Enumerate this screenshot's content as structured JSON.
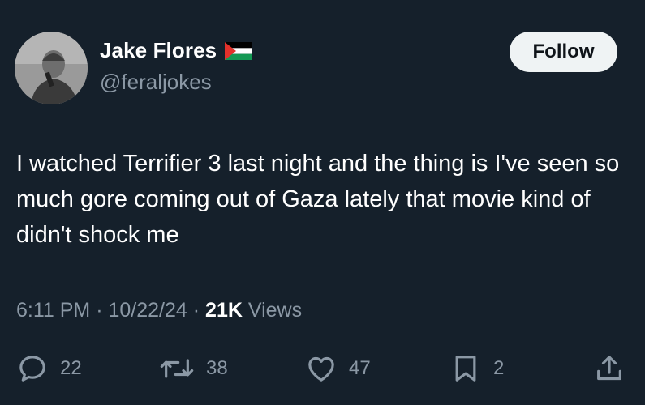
{
  "author": {
    "display_name": "Jake Flores",
    "handle": "@feraljokes",
    "flag_icon": "palestine-flag-icon"
  },
  "follow_button": {
    "label": "Follow"
  },
  "tweet": {
    "text": "I watched Terrifier 3 last night and the thing is I've seen so much gore coming out of Gaza lately that movie kind of didn't shock me"
  },
  "meta": {
    "time": "6:11 PM",
    "separator": "·",
    "date": "10/22/24",
    "views_count": "21K",
    "views_label": "Views"
  },
  "actions": {
    "reply": {
      "icon": "reply-icon",
      "count": "22"
    },
    "retweet": {
      "icon": "retweet-icon",
      "count": "38"
    },
    "like": {
      "icon": "heart-icon",
      "count": "47"
    },
    "bookmark": {
      "icon": "bookmark-icon",
      "count": "2"
    },
    "share": {
      "icon": "share-icon"
    }
  },
  "colors": {
    "background": "#15202b",
    "secondary_text": "#8b98a5",
    "button_bg": "#eff3f4"
  }
}
